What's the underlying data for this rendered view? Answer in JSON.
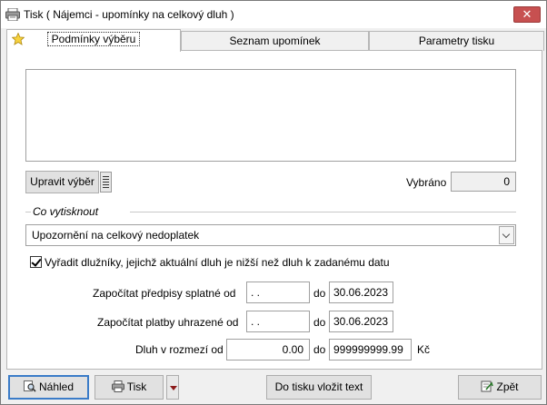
{
  "window": {
    "title": "Tisk ( Nájemci - upomínky na celkový dluh )",
    "close_label": "✕"
  },
  "tabs": [
    {
      "label": "Podmínky výběru",
      "active": true
    },
    {
      "label": "Seznam upomínek",
      "active": false
    },
    {
      "label": "Parametry tisku",
      "active": false
    }
  ],
  "selection": {
    "text_value": "",
    "edit_button_label": "Upravit výběr",
    "selected_label": "Vybráno",
    "selected_count": "0"
  },
  "print_group": {
    "title": "Co vytisknout",
    "selected_option": "Upozornění na celkový nedoplatek",
    "exclude_checkbox_label": "Vyřadit dlužníky, jejichž aktuální dluh je nižší než dluh k zadanému datu",
    "exclude_checked": true
  },
  "filters": {
    "predpisy_label": "Započítat předpisy splatné od",
    "predpisy_from": " .  .",
    "predpisy_to": "30.06.2023",
    "platby_label": "Započítat platby uhrazené od",
    "platby_from": " .  .",
    "platby_to": "30.06.2023",
    "dluh_label": "Dluh v rozmezí od",
    "dluh_from": "0.00",
    "dluh_to": "999999999.99",
    "currency": "Kč",
    "do_label": "do"
  },
  "buttons": {
    "nahled": "Náhled",
    "tisk": "Tisk",
    "do_tisku": "Do tisku vložit text",
    "zpet": "Zpět"
  },
  "colors": {
    "close_button": "#c75050",
    "focus_border": "#3b7cc8",
    "dropdown_arrow": "#8b1a1a"
  },
  "icons": [
    "printer-icon",
    "star-icon",
    "list-icon",
    "magnifier-icon",
    "back-icon"
  ]
}
